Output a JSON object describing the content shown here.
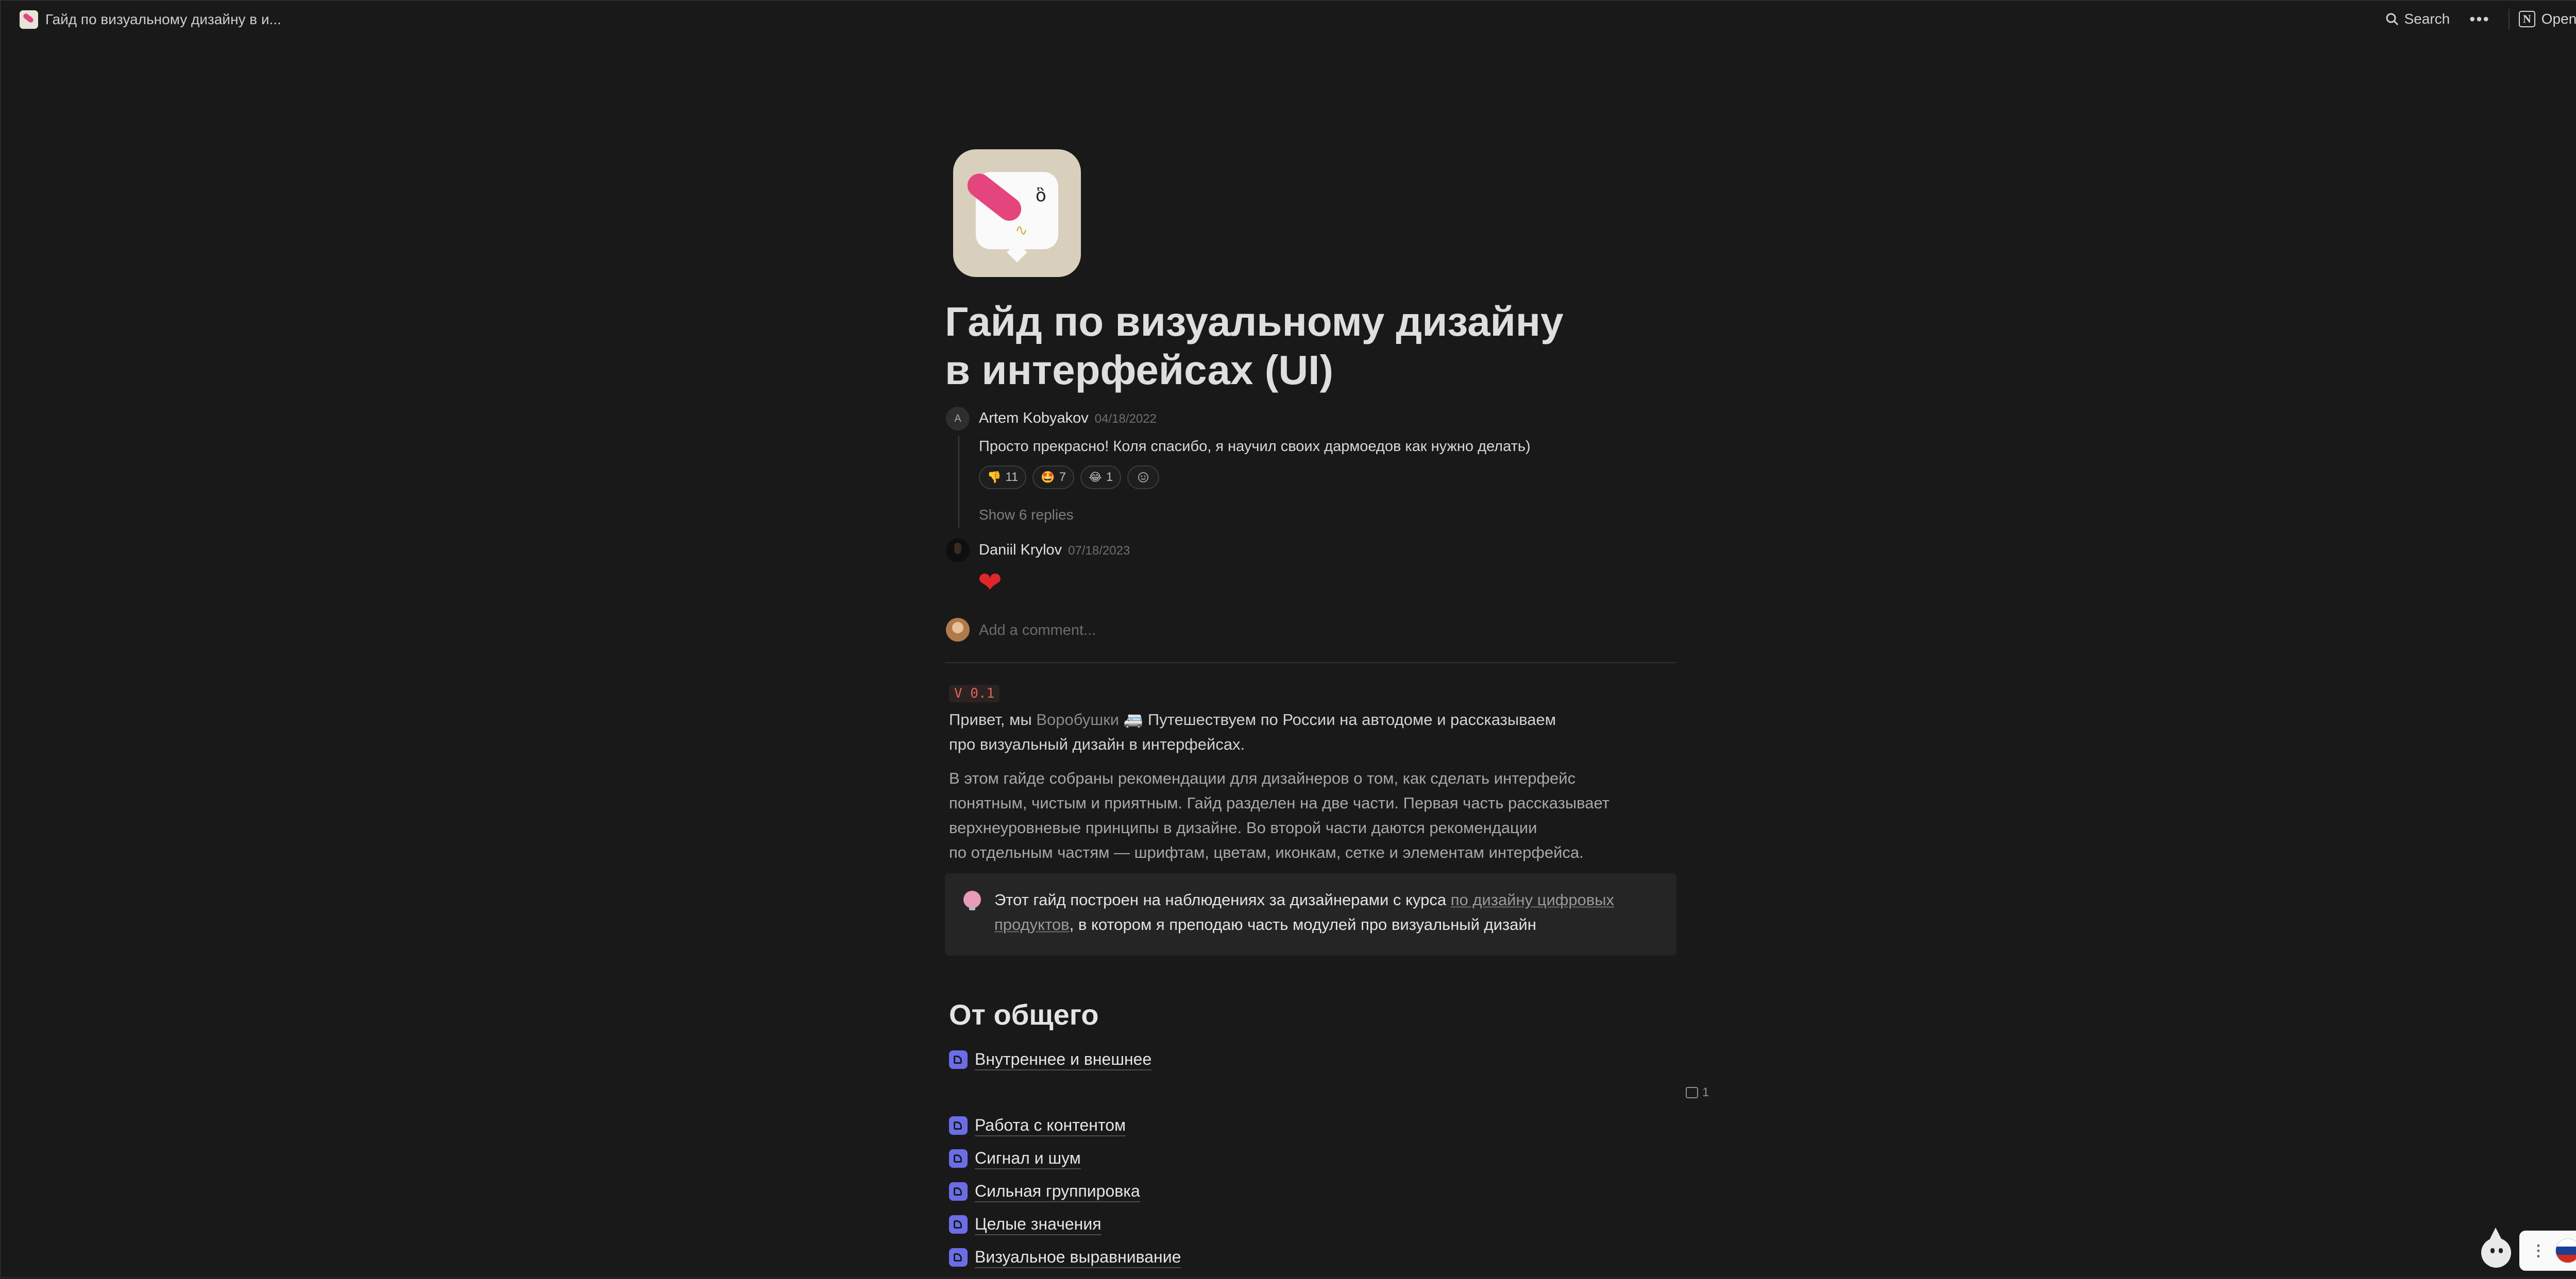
{
  "topbar": {
    "title": "Гайд по визуальному дизайну в и...",
    "search_label": "Search",
    "more_label": "•••",
    "open_label": "Open Notion",
    "notion_letter": "N"
  },
  "page": {
    "title_line1": "Гайд по визуальному дизайну",
    "title_line2": "в интерфейсах (UI)"
  },
  "comments": {
    "first": {
      "avatar_letter": "A",
      "author": "Artem Kobyakov",
      "date": "04/18/2022",
      "body": "Просто прекрасно! Коля спасибо, я научил своих дармоедов как нужно делать)",
      "reactions": [
        {
          "emoji": "👎",
          "count": "11"
        },
        {
          "emoji": "🤩",
          "count": "7"
        },
        {
          "emoji": "😂",
          "count": "1"
        }
      ],
      "show_replies": "Show 6 replies"
    },
    "second": {
      "author": "Daniil Krylov",
      "date": "07/18/2023",
      "body": "❤"
    },
    "add_placeholder": "Add a comment..."
  },
  "content": {
    "version_badge": "V 0.1",
    "intro_prefix": "Привет, мы ",
    "intro_link": "Воробушки",
    "intro_rest": " 🚐 Путешествуем по России на автодоме и рассказываем",
    "intro_line2": "про визуальный дизайн в интерфейсах.",
    "para2_line1": "В этом гайде собраны рекомендации для дизайнеров о том, как сделать интерфейс",
    "para2_line2": "понятным, чистым и приятным. Гайд разделен на две части. Первая часть рассказывает",
    "para2_line3": "верхнеуровневые принципы в дизайне. Во второй части даются рекомендации",
    "para2_line4": "по отдельным частям — шрифтам, цветам, иконкам, сетке и элементам интерфейса.",
    "callout_prefix": "Этот гайд построен на наблюдениях за дизайнерами с курса ",
    "callout_link_line1": "по дизайну цифровых",
    "callout_link_line2": "продуктов",
    "callout_rest": ", в котором я преподаю часть модулей про визуальный дизайн",
    "section_heading": "От общего",
    "pages": [
      "Внутреннее и внешнее",
      "Работа с контентом",
      "Сигнал и шум",
      "Сильная группировка",
      "Целые значения",
      "Визуальное выравнивание"
    ],
    "side_comment_count": "1"
  },
  "colors": {
    "background": "#191919",
    "accent_pink": "#e5457d",
    "page_icon_purple": "#6b6de6"
  }
}
